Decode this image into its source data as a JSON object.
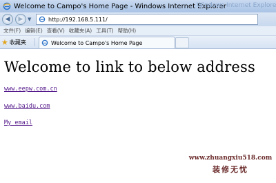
{
  "window": {
    "title": "Welcome to Campo's Home Page - Windows Internet Explorer",
    "ghost_title": "Windows Internet Explorer"
  },
  "address_bar": {
    "url": "http://192.168.5.111/"
  },
  "menu": {
    "items": [
      "文件(F)",
      "编辑(E)",
      "查看(V)",
      "收藏夹(A)",
      "工具(T)",
      "帮助(H)"
    ]
  },
  "tabs": {
    "favorites_label": "收藏夹",
    "active_tab_label": "Welcome to Campo's Home Page"
  },
  "page": {
    "heading": "Welcome to link to below address",
    "links": [
      "www.eepw.com.cn",
      "www.baidu.com",
      "My email"
    ]
  },
  "watermark": {
    "url": "www.zhuangxiu518.com",
    "subtitle": "装修无忧"
  },
  "colors": {
    "visited_link": "#551a8b",
    "titlebar": "#c9daf0",
    "favorites_star": "#e2a31b"
  }
}
